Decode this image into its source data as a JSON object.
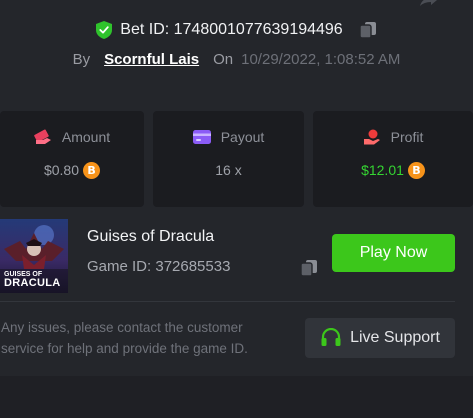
{
  "header": {
    "bet_id_label": "Bet ID: 1748001077639194496",
    "by_label": "By",
    "username": "Scornful Lais",
    "on_label": "On",
    "datetime": "10/29/2022, 1:08:52 AM"
  },
  "stats": [
    {
      "label": "Amount",
      "value": "$0.80",
      "icon": "amount-icon",
      "currency": "B"
    },
    {
      "label": "Payout",
      "value": "16 x",
      "icon": "card-icon"
    },
    {
      "label": "Profit",
      "value": "$12.01",
      "icon": "profit-icon",
      "currency": "B"
    }
  ],
  "game": {
    "thumbnail_line1": "GUISES OF",
    "thumbnail_line2": "DRACULA",
    "title": "Guises of Dracula",
    "game_id_label": "Game ID: 372685533",
    "play_button": "Play Now"
  },
  "support": {
    "help_text": "Any issues, please contact the customer service for help and provide the game ID.",
    "button_label": "Live Support"
  },
  "colors": {
    "background": "#24262b",
    "card": "#1b1c20",
    "accent_green": "#3cc71b",
    "profit_green": "#35d432",
    "bitcoin_orange": "#f7931a",
    "amount_icon": "#e8405e",
    "payout_icon": "#8b5cf6",
    "profit_icon": "#ef3b3b"
  }
}
